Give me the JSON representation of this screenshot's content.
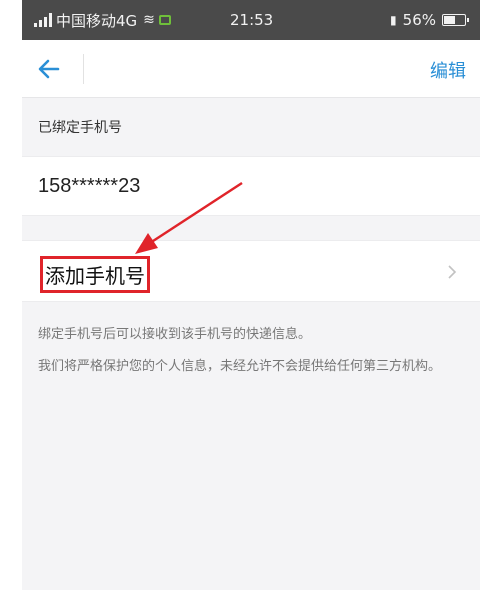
{
  "status_bar": {
    "carrier": "中国移动4G",
    "time": "21:53",
    "battery_text": "56%",
    "battery_level": 0.56
  },
  "nav": {
    "edit_label": "编辑"
  },
  "bound_section": {
    "title": "已绑定手机号",
    "phone": "158******23"
  },
  "add_row": {
    "label": "添加手机号"
  },
  "info": {
    "line1": "绑定手机号后可以接收到该手机号的快递信息。",
    "line2": "我们将严格保护您的个人信息，未经允许不会提供给任何第三方机构。"
  },
  "colors": {
    "accent": "#2a8fd6",
    "highlight": "#e0242a"
  }
}
